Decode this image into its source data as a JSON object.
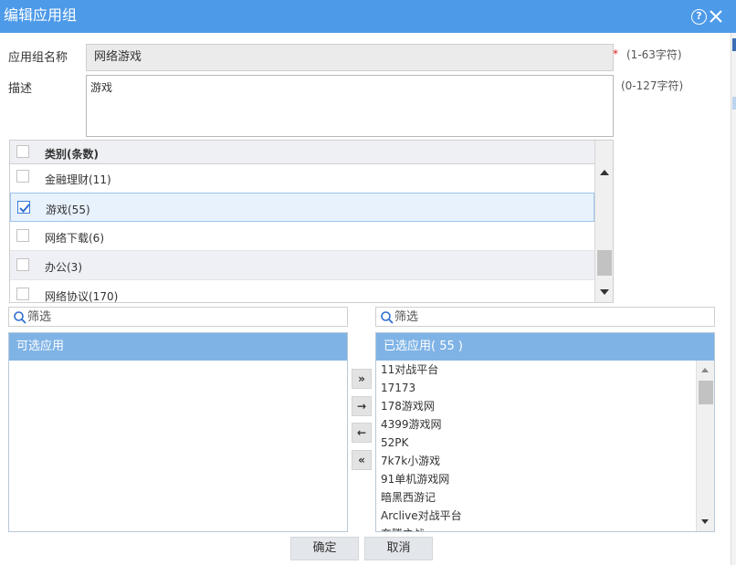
{
  "dialog": {
    "title": "编辑应用组",
    "help_glyph": "?",
    "close_glyph": "×"
  },
  "form": {
    "name_label": "应用组名称",
    "name_value": "网络游戏",
    "name_required_mark": "*",
    "name_hint": "(1-63字符)",
    "desc_label": "描述",
    "desc_value": "游戏",
    "desc_hint": "(0-127字符)"
  },
  "category_grid": {
    "header": "类别(条数)",
    "rows": [
      {
        "label": "金融理财(11)",
        "checked": false
      },
      {
        "label": "游戏(55)",
        "checked": true
      },
      {
        "label": "网络下载(6)",
        "checked": false
      },
      {
        "label": "办公(3)",
        "checked": false
      },
      {
        "label": "网络协议(170)",
        "checked": false
      }
    ]
  },
  "available": {
    "filter_placeholder": "筛选",
    "header": "可选应用"
  },
  "selected": {
    "filter_placeholder": "筛选",
    "header": "已选应用( 55 )",
    "items": [
      "11对战平台",
      "17173",
      "178游戏网",
      "4399游戏网",
      "52PK",
      "7k7k小游戏",
      "91单机游戏网",
      "暗黑西游记",
      "Arclive对战平台",
      "奔腾之战"
    ]
  },
  "move_buttons": {
    "add_all": "»",
    "add": "→",
    "remove": "←",
    "remove_all": "«"
  },
  "footer": {
    "ok_label": "确定",
    "cancel_label": "取消"
  },
  "colors": {
    "titlebar": "#4d9ae8",
    "panel_header": "#7fb3e6",
    "selected_row": "#e8f2fc",
    "required": "#e02020"
  }
}
